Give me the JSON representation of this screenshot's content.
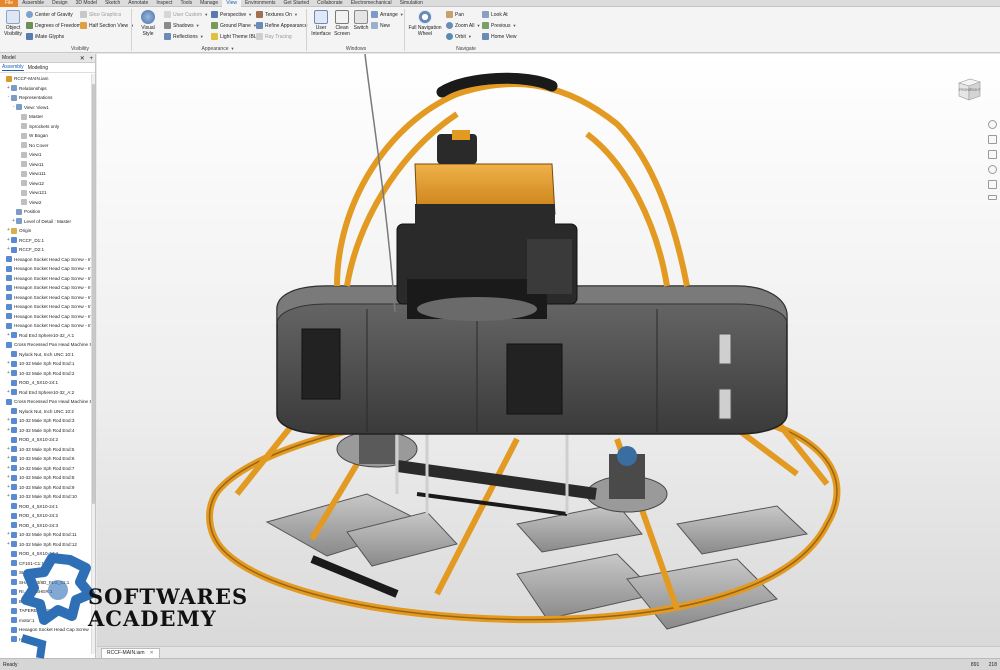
{
  "tabs": [
    "File",
    "Assemble",
    "Design",
    "3D Model",
    "Sketch",
    "Annotate",
    "Inspect",
    "Tools",
    "Manage",
    "View",
    "Environments",
    "Get Started",
    "Collaborate",
    "Electromechanical",
    "Simulation"
  ],
  "active_tab": "View",
  "ribbon": {
    "visibility": {
      "object_visibility": "Object Visibility",
      "center_of_gravity": "Center of Gravity",
      "degrees_of_freedom": "Degrees of Freedom",
      "imate_glyphs": "iMate Glyphs",
      "slice_graphics": "Slice Graphics",
      "half_section_view": "Half Section View",
      "label": "Visibility"
    },
    "appearance": {
      "visual_style": "Visual Style",
      "user_custom": "User Custom",
      "shadows": "Shadows",
      "reflections": "Reflections",
      "perspective": "Perspective",
      "ground_plane": "Ground Plane",
      "light_theme": "Light Theme IBL",
      "textures_on": "Textures On",
      "refine_appearance": "Refine Appearance",
      "ray_tracing": "Ray Tracing",
      "label": "Appearance"
    },
    "windows": {
      "user_interface": "User Interface",
      "clean_screen": "Clean Screen",
      "switch": "Switch",
      "arrange": "Arrange",
      "new": "New",
      "label": "Windows"
    },
    "navigate": {
      "full_navigation_wheel": "Full Navigation Wheel",
      "pan": "Pan",
      "zoom_all": "Zoom All",
      "orbit": "Orbit",
      "look_at": "Look At",
      "previous": "Previous",
      "home_view": "Home View",
      "label": "Navigate"
    }
  },
  "browser": {
    "title": "Model",
    "tabs": [
      "Assembly",
      "Modeling"
    ],
    "active_tab": "Assembly",
    "items": [
      {
        "indent": 0,
        "toggle": "",
        "label": "RCCF-MAIN.iam",
        "color": "#d89a2a"
      },
      {
        "indent": 1,
        "toggle": "+",
        "label": "Relationships",
        "color": "#7a9cc6"
      },
      {
        "indent": 1,
        "toggle": "-",
        "label": "Representations",
        "color": "#7a9cc6"
      },
      {
        "indent": 2,
        "toggle": "-",
        "label": "View: View1",
        "color": "#7a9cc6"
      },
      {
        "indent": 3,
        "toggle": "",
        "label": "Master",
        "color": "#bfbfbf"
      },
      {
        "indent": 3,
        "toggle": "",
        "label": "Sprockets only",
        "color": "#bfbfbf"
      },
      {
        "indent": 3,
        "toggle": "",
        "label": "W Bogan",
        "color": "#bfbfbf"
      },
      {
        "indent": 3,
        "toggle": "",
        "label": "No Cover",
        "color": "#bfbfbf"
      },
      {
        "indent": 3,
        "toggle": "",
        "label": "View1",
        "color": "#bfbfbf"
      },
      {
        "indent": 3,
        "toggle": "",
        "label": "View11",
        "color": "#bfbfbf"
      },
      {
        "indent": 3,
        "toggle": "",
        "label": "View111",
        "color": "#bfbfbf"
      },
      {
        "indent": 3,
        "toggle": "",
        "label": "View12",
        "color": "#bfbfbf"
      },
      {
        "indent": 3,
        "toggle": "",
        "label": "View121",
        "color": "#bfbfbf"
      },
      {
        "indent": 3,
        "toggle": "",
        "label": "View2",
        "color": "#bfbfbf"
      },
      {
        "indent": 2,
        "toggle": "",
        "label": "Position",
        "color": "#7a9cc6"
      },
      {
        "indent": 2,
        "toggle": "+",
        "label": "Level of Detail : Master",
        "color": "#7a9cc6"
      },
      {
        "indent": 1,
        "toggle": "+",
        "label": "Origin",
        "color": "#d8b04a"
      },
      {
        "indent": 1,
        "toggle": "+",
        "label": "RCCF_D1:1",
        "color": "#5a8bd1"
      },
      {
        "indent": 1,
        "toggle": "+",
        "label": "RCCF_D2:1",
        "color": "#5a8bd1"
      },
      {
        "indent": 1,
        "toggle": "",
        "label": "Hexagon Socket Head Cap Screw - Inch",
        "color": "#5a8bd1"
      },
      {
        "indent": 1,
        "toggle": "",
        "label": "Hexagon Socket Head Cap Screw - Inch",
        "color": "#5a8bd1"
      },
      {
        "indent": 1,
        "toggle": "",
        "label": "Hexagon Socket Head Cap Screw - Inch",
        "color": "#5a8bd1"
      },
      {
        "indent": 1,
        "toggle": "",
        "label": "Hexagon Socket Head Cap Screw - Inch",
        "color": "#5a8bd1"
      },
      {
        "indent": 1,
        "toggle": "",
        "label": "Hexagon Socket Head Cap Screw - Inch",
        "color": "#5a8bd1"
      },
      {
        "indent": 1,
        "toggle": "",
        "label": "Hexagon Socket Head Cap Screw - Inch",
        "color": "#5a8bd1"
      },
      {
        "indent": 1,
        "toggle": "",
        "label": "Hexagon Socket Head Cap Screw - Inch",
        "color": "#5a8bd1"
      },
      {
        "indent": 1,
        "toggle": "",
        "label": "Hexagon Socket Head Cap Screw - Inch",
        "color": "#5a8bd1"
      },
      {
        "indent": 1,
        "toggle": "+",
        "label": "Rod End Sphere10-32_A:1",
        "color": "#5a8bd1"
      },
      {
        "indent": 1,
        "toggle": "",
        "label": "Cross Recessed Pan Head Machine Screw",
        "color": "#5a8bd1"
      },
      {
        "indent": 1,
        "toggle": "",
        "label": "Nylock Nut, Inch UNC 10:1",
        "color": "#5a8bd1"
      },
      {
        "indent": 1,
        "toggle": "+",
        "label": "10-32 Male Sph Rod End:1",
        "color": "#5a8bd1"
      },
      {
        "indent": 1,
        "toggle": "+",
        "label": "10-32 Male Sph Rod End:2",
        "color": "#5a8bd1"
      },
      {
        "indent": 1,
        "toggle": "",
        "label": "ROD_4_5X10-24:1",
        "color": "#5a8bd1"
      },
      {
        "indent": 1,
        "toggle": "+",
        "label": "Rod End Sphere10-32_A:2",
        "color": "#5a8bd1"
      },
      {
        "indent": 1,
        "toggle": "",
        "label": "Cross Recessed Pan Head Machine Screw",
        "color": "#5a8bd1"
      },
      {
        "indent": 1,
        "toggle": "",
        "label": "Nylock Nut, Inch UNC 10:2",
        "color": "#5a8bd1"
      },
      {
        "indent": 1,
        "toggle": "+",
        "label": "10-32 Male Sph Rod End:3",
        "color": "#5a8bd1"
      },
      {
        "indent": 1,
        "toggle": "+",
        "label": "10-32 Male Sph Rod End:4",
        "color": "#5a8bd1"
      },
      {
        "indent": 1,
        "toggle": "",
        "label": "ROD_4_5X10-24:2",
        "color": "#5a8bd1"
      },
      {
        "indent": 1,
        "toggle": "+",
        "label": "10-32 Male Sph Rod End:5",
        "color": "#5a8bd1"
      },
      {
        "indent": 1,
        "toggle": "+",
        "label": "10-32 Male Sph Rod End:6",
        "color": "#5a8bd1"
      },
      {
        "indent": 1,
        "toggle": "+",
        "label": "10-32 Male Sph Rod End:7",
        "color": "#5a8bd1"
      },
      {
        "indent": 1,
        "toggle": "+",
        "label": "10-32 Male Sph Rod End:8",
        "color": "#5a8bd1"
      },
      {
        "indent": 1,
        "toggle": "+",
        "label": "10-32 Male Sph Rod End:9",
        "color": "#5a8bd1"
      },
      {
        "indent": 1,
        "toggle": "+",
        "label": "10-32 Male Sph Rod End:10",
        "color": "#5a8bd1"
      },
      {
        "indent": 1,
        "toggle": "",
        "label": "ROD_4_5X10-24:1",
        "color": "#5a8bd1"
      },
      {
        "indent": 1,
        "toggle": "",
        "label": "ROD_4_5X10-24:2",
        "color": "#5a8bd1"
      },
      {
        "indent": 1,
        "toggle": "",
        "label": "ROD_4_5X10-24:3",
        "color": "#5a8bd1"
      },
      {
        "indent": 1,
        "toggle": "+",
        "label": "10-32 Male Sph Rod End:11",
        "color": "#5a8bd1"
      },
      {
        "indent": 1,
        "toggle": "+",
        "label": "10-32 Male Sph Rod End:12",
        "color": "#5a8bd1"
      },
      {
        "indent": 1,
        "toggle": "",
        "label": "ROD_4_5X10-24:4",
        "color": "#5a8bd1"
      },
      {
        "indent": 1,
        "toggle": "",
        "label": "CF101-C1:1",
        "color": "#5a8bd1"
      },
      {
        "indent": 1,
        "toggle": "",
        "label": "SHAFT COU",
        "color": "#5a8bd1"
      },
      {
        "indent": 1,
        "toggle": "",
        "label": "SHAFT_3/8D_FLG_01:1",
        "color": "#5a8bd1"
      },
      {
        "indent": 1,
        "toggle": "",
        "label": "RI... WASHER:1",
        "color": "#5a8bd1"
      },
      {
        "indent": 1,
        "toggle": "",
        "label": "B... RING:1",
        "color": "#5a8bd1"
      },
      {
        "indent": 1,
        "toggle": "",
        "label": "TAPERED ... SHAFT:1",
        "color": "#5a8bd1"
      },
      {
        "indent": 1,
        "toggle": "",
        "label": "motor:1",
        "color": "#5a8bd1"
      },
      {
        "indent": 1,
        "toggle": "",
        "label": "Hexagon Socket Head Cap Screw",
        "color": "#5a8bd1"
      },
      {
        "indent": 1,
        "toggle": "",
        "label": "Hexagon",
        "color": "#5a8bd1"
      }
    ]
  },
  "document_tab": "RCCF-MAIN.iam",
  "status": {
    "text": "Ready",
    "value_a": "891",
    "value_b": "218"
  },
  "watermark": {
    "line1": "SOFTWARES",
    "line2": "ACADEMY"
  },
  "viewcube": {
    "face_front": "FRONT",
    "face_right": "RIGHT"
  },
  "colors": {
    "accent_orange": "#e8a33a",
    "frame_orange": "#e39a22",
    "body_gray": "#4a4a4a",
    "file_tab": "#e8862a",
    "active_blue": "#1a5fb4"
  }
}
